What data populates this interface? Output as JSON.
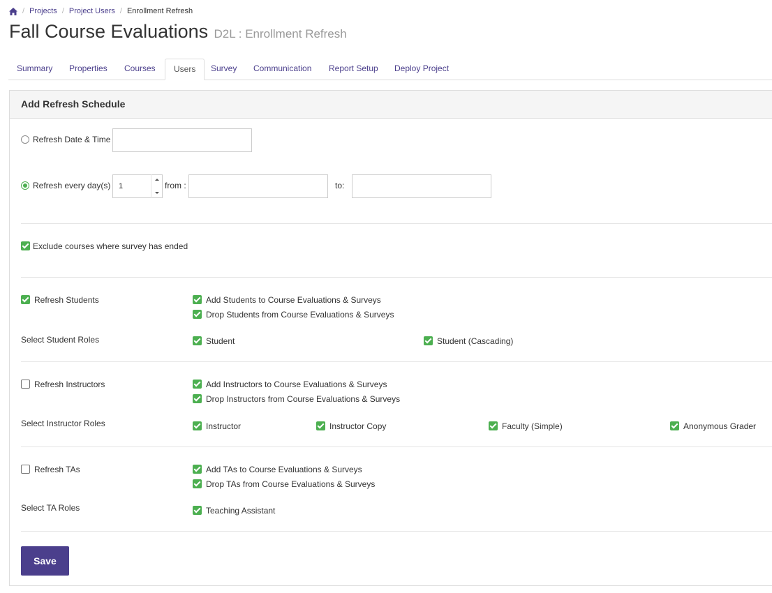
{
  "breadcrumb": {
    "projects": "Projects",
    "project_users": "Project Users",
    "current": "Enrollment Refresh"
  },
  "header": {
    "title": "Fall Course Evaluations",
    "subtitle": "D2L : Enrollment Refresh"
  },
  "tabs": [
    {
      "label": "Summary"
    },
    {
      "label": "Properties"
    },
    {
      "label": "Courses"
    },
    {
      "label": "Users"
    },
    {
      "label": "Survey"
    },
    {
      "label": "Communication"
    },
    {
      "label": "Report Setup"
    },
    {
      "label": "Deploy Project"
    }
  ],
  "active_tab": "Users",
  "panel": {
    "title": "Add Refresh Schedule"
  },
  "schedule": {
    "date_time_label": "Refresh Date & Time",
    "date_time_value": "",
    "every_label": "Refresh every day(s)",
    "every_value": "1",
    "from_label": "from :",
    "from_value": "",
    "to_label": "to:",
    "to_value": "",
    "selected_mode": "every"
  },
  "exclude": {
    "label": "Exclude courses where survey has ended",
    "checked": true
  },
  "students": {
    "refresh_label": "Refresh Students",
    "refresh_checked": true,
    "add_label": "Add Students to Course Evaluations & Surveys",
    "add_checked": true,
    "drop_label": "Drop Students from Course Evaluations & Surveys",
    "drop_checked": true,
    "roles_label": "Select Student Roles",
    "roles": [
      {
        "label": "Student",
        "checked": true
      },
      {
        "label": "Student (Cascading)",
        "checked": true
      }
    ]
  },
  "instructors": {
    "refresh_label": "Refresh Instructors",
    "refresh_checked": false,
    "add_label": "Add Instructors to Course Evaluations & Surveys",
    "add_checked": true,
    "drop_label": "Drop Instructors from Course Evaluations & Surveys",
    "drop_checked": true,
    "roles_label": "Select Instructor Roles",
    "roles": [
      {
        "label": "Instructor",
        "checked": true
      },
      {
        "label": "Instructor Copy",
        "checked": true
      },
      {
        "label": "Faculty (Simple)",
        "checked": true
      },
      {
        "label": "Anonymous Grader",
        "checked": true
      }
    ]
  },
  "tas": {
    "refresh_label": "Refresh TAs",
    "refresh_checked": false,
    "add_label": "Add TAs to Course Evaluations & Surveys",
    "add_checked": true,
    "drop_label": "Drop TAs from Course Evaluations & Surveys",
    "drop_checked": true,
    "roles_label": "Select TA Roles",
    "roles": [
      {
        "label": "Teaching Assistant",
        "checked": true
      }
    ]
  },
  "actions": {
    "save_label": "Save"
  },
  "colors": {
    "accent": "#4b3f8c",
    "check": "#4caf50",
    "panel_header_bg": "#f5f5f5"
  }
}
